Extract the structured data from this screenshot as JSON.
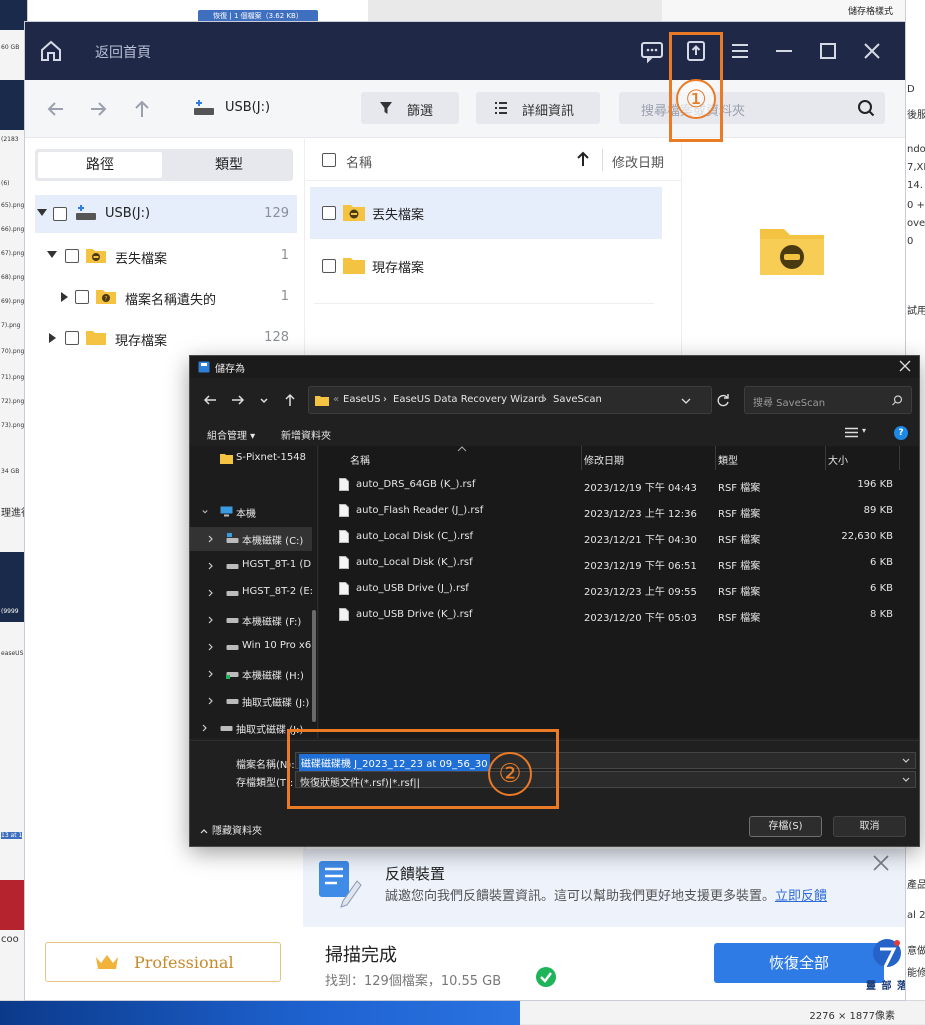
{
  "background": {
    "top_pill": "恢復 | 1 個檔案（3.62 KB）",
    "top_right_toolbar": "儲存格樣式",
    "right_edge_texts": [
      "D",
      "後服",
      "ndow",
      "7,XI",
      "14.",
      "0 + E",
      "overy",
      "0",
      "試用",
      "產品",
      "al 20",
      "意做",
      "能修"
    ],
    "left_edge_texts": [
      "60 GB",
      "(2183",
      "(6)",
      "65).png",
      "66).png",
      "67).png",
      "68).png",
      "69).png",
      "7).png",
      "70).png",
      "71).png",
      "72).png",
      "73).png",
      "34 GB",
      "理進行",
      "(9999",
      "easeUS",
      "13 at 1",
      "coo"
    ],
    "image_size_label": "2276 × 1877像素"
  },
  "easeus": {
    "title": "返回首頁",
    "toolbar": {
      "drive": "USB(J:)",
      "filter_label": "篩選",
      "details_label": "詳細資訊",
      "search_placeholder": "搜尋檔案或資料夾"
    },
    "callout_1": "①",
    "left_panel": {
      "seg_path": "路徑",
      "seg_type": "類型",
      "tree": [
        {
          "name": "USB(J:)",
          "count": "129"
        },
        {
          "name": "丟失檔案",
          "count": "1"
        },
        {
          "name": "檔案名稱遺失的",
          "count": "1"
        },
        {
          "name": "現存檔案",
          "count": "128"
        }
      ],
      "professional_label": "Professional"
    },
    "file_list": {
      "col_name": "名稱",
      "col_date": "修改日期",
      "rows": [
        "丟失檔案",
        "現存檔案"
      ]
    },
    "feedback": {
      "title": "反饋裝置",
      "desc": "誠邀您向我們反饋裝置資訊。這可以幫助我們更好地支援更多裝置。",
      "link": "立即反饋"
    },
    "status": {
      "title": "掃描完成",
      "found": "找到：129個檔案，10.55 GB",
      "recover_all": "恢復全部",
      "watermark_text": "靈 部 落"
    }
  },
  "saveas": {
    "title": "儲存為",
    "address": [
      "EaseUS",
      "EaseUS Data Recovery Wizard",
      "SaveScan"
    ],
    "search_placeholder": "搜尋 SaveScan",
    "organize": "組合管理 ▾",
    "new_folder": "新增資料夾",
    "help": "?",
    "nav": [
      {
        "label": "S-Pixnet-1548"
      },
      {
        "label": "本機"
      },
      {
        "label": "本機磁碟 (C:)"
      },
      {
        "label": "HGST_8T-1 (D"
      },
      {
        "label": "HGST_8T-2 (E:"
      },
      {
        "label": "本機磁碟 (F:)"
      },
      {
        "label": "Win 10 Pro x6"
      },
      {
        "label": "本機磁碟 (H:)"
      },
      {
        "label": "抽取式磁碟 (J:)"
      },
      {
        "label": "抽取式磁碟 (J:)"
      }
    ],
    "columns": {
      "name": "名稱",
      "date": "修改日期",
      "type": "類型",
      "size": "大小"
    },
    "files": [
      {
        "name": "auto_DRS_64GB (K_).rsf",
        "date": "2023/12/19 下午 04:43",
        "type": "RSF 檔案",
        "size": "196 KB"
      },
      {
        "name": "auto_Flash Reader (J_).rsf",
        "date": "2023/12/23 上午 12:36",
        "type": "RSF 檔案",
        "size": "89 KB"
      },
      {
        "name": "auto_Local Disk (C_).rsf",
        "date": "2023/12/21 下午 04:30",
        "type": "RSF 檔案",
        "size": "22,630 KB"
      },
      {
        "name": "auto_Local Disk (K_).rsf",
        "date": "2023/12/19 下午 06:51",
        "type": "RSF 檔案",
        "size": "6 KB"
      },
      {
        "name": "auto_USB Drive (J_).rsf",
        "date": "2023/12/23 上午 09:55",
        "type": "RSF 檔案",
        "size": "6 KB"
      },
      {
        "name": "auto_USB Drive (K_).rsf",
        "date": "2023/12/20 下午 05:03",
        "type": "RSF 檔案",
        "size": "8 KB"
      }
    ],
    "filename_label": "檔案名稱(N):",
    "filename_value": "磁碟磁碟機 J_2023_12_23 at 09_56_30",
    "filetype_label": "存檔類型(T):",
    "filetype_value": "恢復狀態文件(*.rsf)|*.rsf||",
    "hide_folders": "隱藏資料夾",
    "save_button": "存檔(S)",
    "cancel_button": "取消",
    "callout_2": "②"
  },
  "colors": {
    "titlebar": "#1f2846",
    "accent_orange": "#ea7a26",
    "primary_blue": "#2e7be6",
    "folder_yellow": "#f5c342"
  }
}
